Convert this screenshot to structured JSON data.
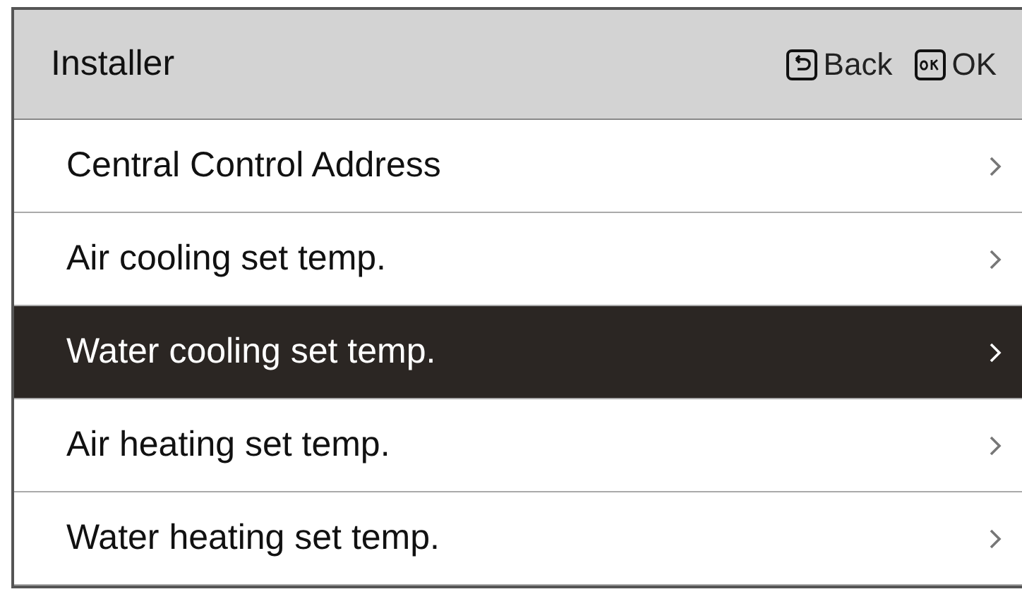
{
  "header": {
    "title": "Installer",
    "actions": [
      {
        "kind": "back",
        "label": "Back"
      },
      {
        "kind": "ok",
        "label": "OK"
      }
    ]
  },
  "menu": [
    {
      "label": "Central Control Address",
      "selected": false
    },
    {
      "label": "Air cooling set temp.",
      "selected": false
    },
    {
      "label": "Water cooling set temp.",
      "selected": true
    },
    {
      "label": "Air heating set temp.",
      "selected": false
    },
    {
      "label": "Water heating set temp.",
      "selected": false
    }
  ]
}
